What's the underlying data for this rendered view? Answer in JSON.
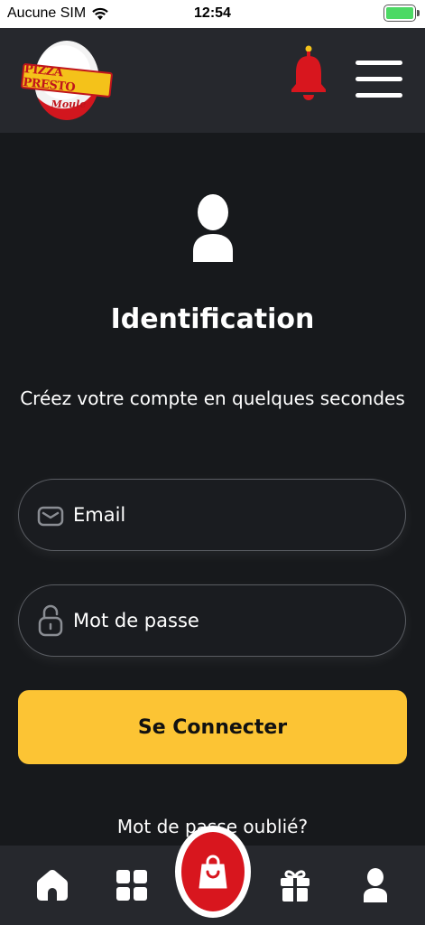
{
  "status_bar": {
    "carrier": "Aucune SIM",
    "time": "12:54",
    "battery_level": 1.0
  },
  "header": {
    "logo": {
      "text_main": "PIZZA PRESTO",
      "text_sub": "Moule"
    },
    "notification_icon": "bell-icon",
    "menu_icon": "hamburger-menu-icon"
  },
  "login": {
    "icon": "user-icon",
    "title": "Identification",
    "subtitle": "Créez votre compte en quelques secondes",
    "email_placeholder": "Email",
    "email_icon": "envelope-icon",
    "password_placeholder": "Mot de passe",
    "password_icon": "unlock-icon",
    "submit_label": "Se Connecter",
    "forgot_link": "Mot de passe oublié?"
  },
  "bottom_nav": {
    "items": [
      {
        "icon": "home-icon"
      },
      {
        "icon": "grid-icon"
      },
      {
        "icon": "shopping-bag-icon"
      },
      {
        "icon": "gift-icon"
      },
      {
        "icon": "user-icon"
      }
    ]
  },
  "colors": {
    "background": "#17191c",
    "header": "#26282d",
    "accent_yellow": "#fcc434",
    "accent_red": "#d8161e",
    "field_border": "#5a5d63"
  }
}
